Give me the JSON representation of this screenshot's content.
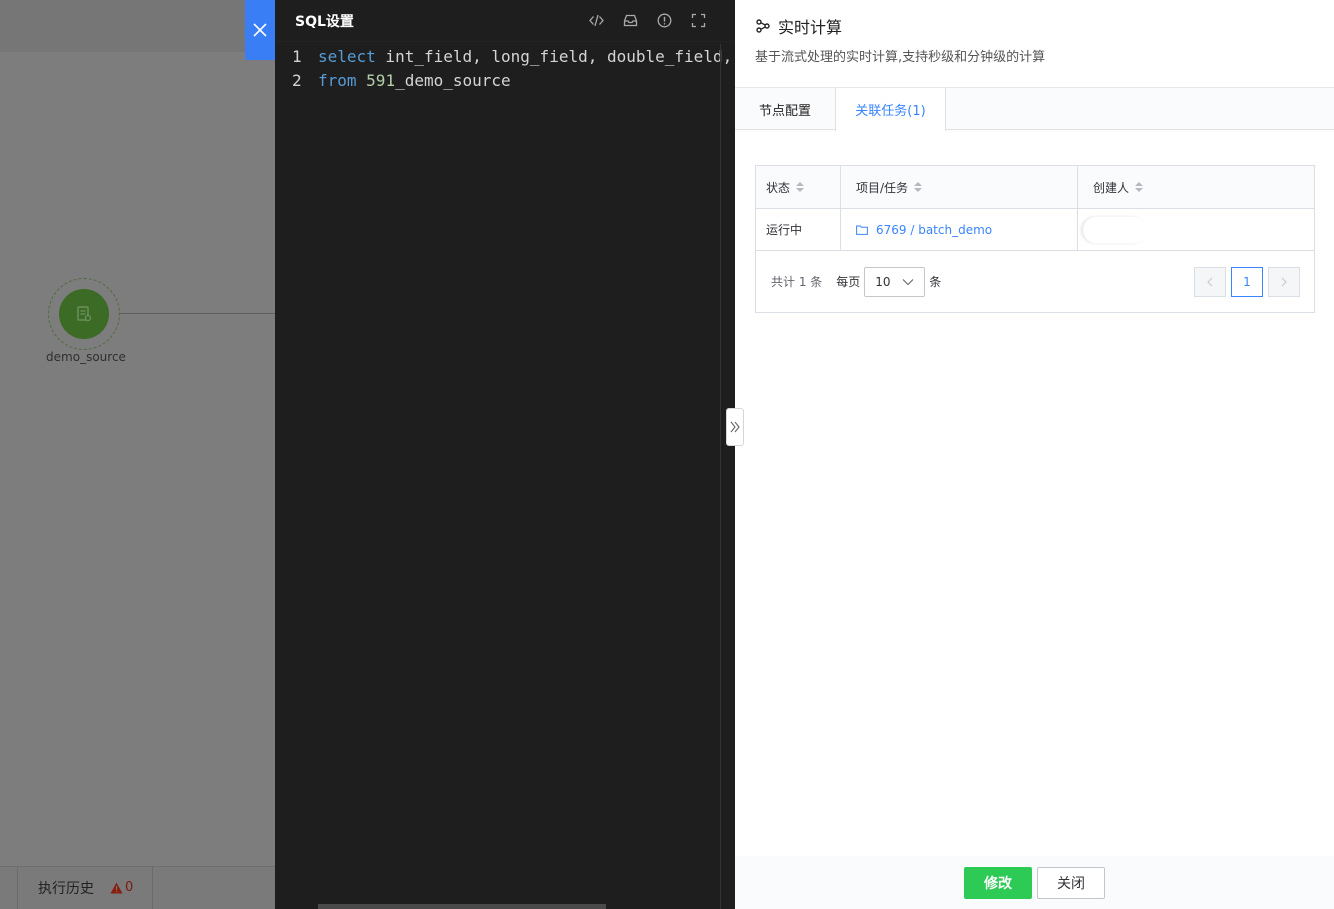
{
  "canvas": {
    "node_label": "demo_source",
    "history_label": "执行历史",
    "warning_count": "0"
  },
  "editor": {
    "title": "SQL设置",
    "tools": [
      "code-icon",
      "inbox-icon",
      "info-icon",
      "fullscreen-icon"
    ],
    "lines": [
      {
        "num": "1",
        "kw": "select",
        "text": " int_field, long_field, double_field,",
        "number": "",
        "rest": ""
      },
      {
        "num": "2",
        "kw": "from",
        "text": " ",
        "number": "591",
        "rest": "_demo_source"
      }
    ]
  },
  "panel": {
    "title": "实时计算",
    "description": "基于流式处理的实时计算,支持秒级和分钟级的计算",
    "tabs": [
      "节点配置",
      "关联任务(1)"
    ],
    "active_tab": 1,
    "table": {
      "headers": [
        "状态",
        "项目/任务",
        "创建人"
      ],
      "rows": [
        {
          "status": "运行中",
          "project_task": "6769 / batch_demo",
          "creator": ""
        }
      ]
    },
    "pagination": {
      "total": "共计 1 条",
      "per_page_label": "每页",
      "per_page": "10",
      "unit": "条",
      "current_page": "1"
    },
    "footer": {
      "modify": "修改",
      "close": "关闭"
    }
  },
  "colors": {
    "accent": "#3a84ff",
    "primary_button": "#2dcb56",
    "close_bar": "#3a7ef6",
    "node": "#3c6b26",
    "warning": "#c8301c"
  }
}
